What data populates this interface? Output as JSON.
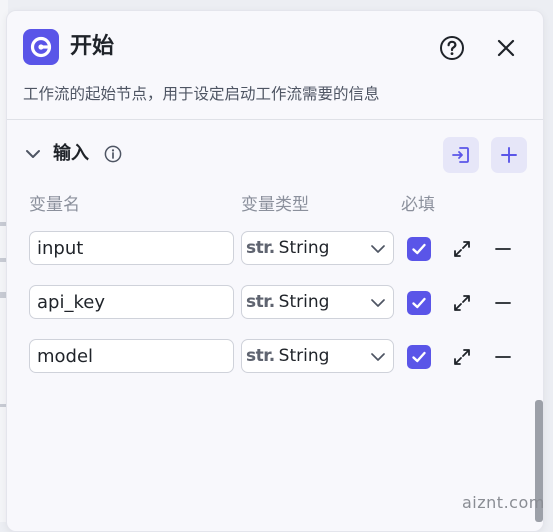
{
  "header": {
    "title": "开始",
    "description": "工作流的起始节点，用于设定启动工作流需要的信息",
    "logo_icon": "start-node-icon",
    "help_icon": "help-circle-icon",
    "close_icon": "close-icon"
  },
  "input_section": {
    "title": "输入",
    "expanded": true,
    "columns": {
      "name": "变量名",
      "type": "变量类型",
      "required": "必填"
    },
    "rows": [
      {
        "name": "input",
        "type_prefix": "str.",
        "type": "String",
        "required": true
      },
      {
        "name": "api_key",
        "type_prefix": "str.",
        "type": "String",
        "required": true
      },
      {
        "name": "model",
        "type_prefix": "str.",
        "type": "String",
        "required": true
      }
    ]
  },
  "watermark": "aiznt.com",
  "colors": {
    "accent": "#5a55e8",
    "accent_soft": "#e6e6f8",
    "text": "#1f2329",
    "muted": "#8b909c"
  }
}
